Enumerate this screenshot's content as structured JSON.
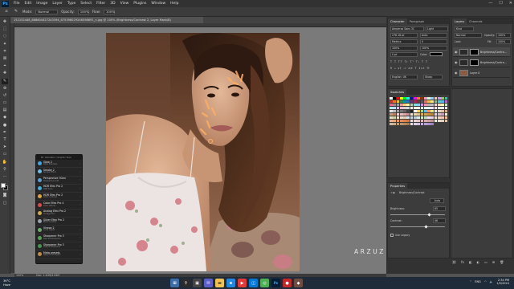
{
  "app": {
    "logo": "Ps"
  },
  "menu": [
    "File",
    "Edit",
    "Image",
    "Layer",
    "Type",
    "Select",
    "Filter",
    "3D",
    "View",
    "Plugins",
    "Window",
    "Help"
  ],
  "window_controls": [
    "—",
    "☐",
    "✕"
  ],
  "options": {
    "mode_label": "Mode:",
    "mode_value": "Normal",
    "opacity_label": "Opacity:",
    "opacity_value": "100%",
    "flow_label": "Flow:",
    "flow_value": "100%"
  },
  "document_tab": "152152448_888604427243394_875398029246598691_n.jpg @ 100% (Brightness/Contrast 2, Layer Mask/8)",
  "status": {
    "zoom": "100%",
    "doc": "Doc: 1.40M/4.64M"
  },
  "watermark": "ARZUZ CREATION",
  "plugin_panel": {
    "header": "Mr. Calculator / Graphic Tools",
    "items": [
      {
        "name": "Glow 2",
        "sub": "Glow Shadows",
        "color": "#3aa7e8"
      },
      {
        "name": "Smoke 2",
        "sub": "Smoke Effect",
        "color": "#66c0ee"
      },
      {
        "name": "Perspective 3Gen",
        "sub": "Perspective edit",
        "color": "#4fa0e0"
      },
      {
        "name": "HDR Efex Pro 2",
        "sub": "HDR tone",
        "color": "#3cb0e0"
      },
      {
        "name": "HDR Efex Pro 2",
        "sub": "Color contrast",
        "color": "#e5a23a"
      },
      {
        "name": "Color Efex Pro 4",
        "sub": "Color effects",
        "color": "#e04848"
      },
      {
        "name": "Analog Efex Pro 2",
        "sub": "Vintage film",
        "color": "#d9a640"
      },
      {
        "name": "Silver Efex Pro 2",
        "sub": "Black & white",
        "color": "#9aa3ad"
      },
      {
        "name": "Viveza 2",
        "sub": "Local adjust",
        "color": "#5fb55f"
      },
      {
        "name": "Sharpener Pro 3",
        "sub": "Raw Presharpener",
        "color": "#48a852"
      },
      {
        "name": "Sharpener Pro 3",
        "sub": "Output Sharpener",
        "color": "#3d9a48"
      },
      {
        "name": "Meta presets",
        "sub": "Apply to all layers",
        "color": "#c7893d"
      }
    ]
  },
  "character": {
    "tabs": [
      "Character",
      "Paragraph"
    ],
    "font": "Ampersa Sans 3C",
    "style": "Light",
    "size": "276.16 pt",
    "leading": "Auto",
    "kerning": "Metrics",
    "tracking": "0",
    "vscale": "100%",
    "hscale": "100%",
    "baseline": "0 pt",
    "color_label": "Color:",
    "glyph_row": "T T TT Tr T¹ T₁ T T",
    "lang": "English: UK",
    "aa": "Sharp"
  },
  "layers": {
    "tabs": [
      "Layers",
      "Channels"
    ],
    "kind": "Kind",
    "blend": "Normal",
    "opacity_label": "Opacity:",
    "opacity": "100%",
    "fill_label": "Fill:",
    "fill": "100%",
    "lock_label": "Lock:",
    "items": [
      {
        "name": "Brightness/Contra...",
        "thumb": "#2a2a2a"
      },
      {
        "name": "Brightness/Contra...",
        "thumb": "#2a2a2a"
      },
      {
        "name": "Layer 0",
        "thumb": "#8a5b42"
      }
    ]
  },
  "swatches": {
    "tab": "Swatches",
    "colors": [
      "#ffffff",
      "#000000",
      "#ff0000",
      "#ffff00",
      "#00ff00",
      "#00ffff",
      "#0000ff",
      "#ff00ff",
      "#ff7f00",
      "#7f3f00",
      "#ff99cc",
      "#ccffcc",
      "#99ccff",
      "#ffcc99",
      "#cc99ff",
      "#9ccc65",
      "#4db6ac",
      "#d32f2f",
      "#f57c00",
      "#fbc02d",
      "#388e3c",
      "#0097a7",
      "#1976d2",
      "#7b1fa2",
      "#c2185b",
      "#5d4037",
      "#455a64",
      "#e57373",
      "#ffb74d",
      "#fff176",
      "#81c784",
      "#4dd0e1",
      "#64b5f6",
      "#ba68c8",
      "#f06292",
      "#a1887f",
      "#90a4ae",
      "#ef9a9a",
      "#ffcc80",
      "#fff59d",
      "#a5d6a7",
      "#80deea",
      "#90caf9",
      "#ce93d8",
      "#f48fb1",
      "#bcaaa4",
      "#b0bec5",
      "#ffcdd2",
      "#ffe0b2",
      "#fff9c4",
      "#c8e6c9",
      "#b2ebf2",
      "#bbdefb",
      "#e1bee7",
      "#f8bbd0",
      "#d7ccc8",
      "#cfd8dc",
      "#ffebee",
      "#fff3e0",
      "#fffde7",
      "#e8f5e9",
      "#e0f7fa",
      "#e3f2fd",
      "#f3e5f5",
      "#fce4ec",
      "#efebe9",
      "#eceff1",
      "#f5f5f5",
      "#e0e0e0",
      "#bdbdbd",
      "#9e9e9e",
      "#757575",
      "#616161",
      "#424242",
      "#212121",
      "#fafafa",
      "#ffd54f",
      "#aed581",
      "#4fc3f7",
      "#ff8a65",
      "#dce775",
      "#f0e4d8",
      "#ead6c4",
      "#e2c3a8",
      "#d8ad8c",
      "#c99572",
      "#b5805e",
      "#f2d6d6",
      "#e8c0c0",
      "#dba7a7",
      "#cd8d8d",
      "#f5e6c8",
      "#ecd6a8",
      "#e2c48a",
      "#d8b36e",
      "#cfa254",
      "#c4933c",
      "#b8852a",
      "#e8d0e0",
      "#d8b8cc",
      "#c8a0b8",
      "#f0f0d8",
      "#e0e0c0",
      "#d0d0a8",
      "#f8e8d8",
      "#f0dcc8",
      "#e8d0b8",
      "#d8e8f0",
      "#c8dce8",
      "#b8d0e0",
      "#e0f0e0",
      "#d0e8d0",
      "#c0e0c0",
      "#f0e0f0",
      "#e8d0e8",
      "#fce0cc",
      "#f8d4bc",
      "#f4c8ac",
      "#f0bc9c",
      "#ecb08c",
      "#e8a47c",
      "#e4986c",
      "#e08c5c",
      "#dc804c",
      "#d8743c",
      "#f4dcdc",
      "#ecd0d0",
      "#e4c4c4",
      "#dcb8b8",
      "#d4acac",
      "#cca0a0",
      "#c49494",
      "#f2e8dc",
      "#eadccc",
      "#e2d0bc",
      "#dac4ac",
      "#d2b89c",
      "#caac8c",
      "#c2a07c",
      "#ba946c",
      "#b2885c",
      "#aa7c4c",
      "#e8e0f0",
      "#dcd0e8",
      "#d0c0e0",
      "#c4b0d8",
      "#b8a0d0",
      "#ac90c8",
      "#a080c0"
    ]
  },
  "properties": {
    "tab": "Properties",
    "title": "Brightness/Contrast",
    "auto": "Auto",
    "brightness_label": "Brightness:",
    "brightness": "65",
    "brightness_frac": 0.72,
    "contrast_label": "Contrast:",
    "contrast": "46",
    "contrast_frac": 0.66,
    "legacy": "Use Legacy"
  },
  "taskbar": {
    "temp": "36°C",
    "weather": "Haze",
    "search": "Search",
    "time": "2:34 PM",
    "date": "1/5/2024",
    "lang": "ENG"
  }
}
